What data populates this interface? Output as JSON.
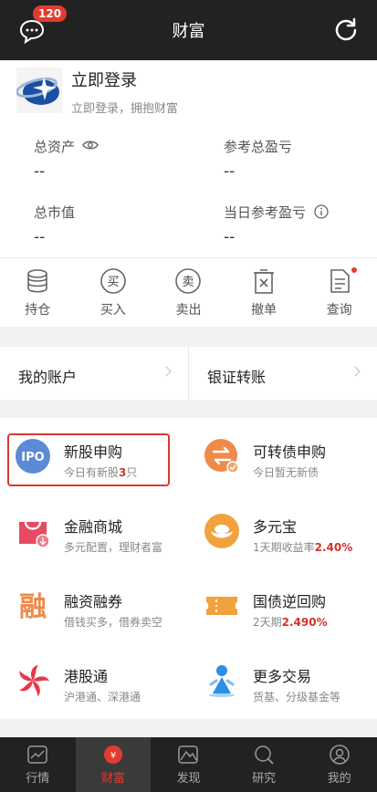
{
  "header": {
    "title": "财富",
    "message_badge": "120"
  },
  "account": {
    "login_title": "立即登录",
    "login_subtitle": "立即登录，拥抱财富",
    "stats": [
      {
        "label": "总资产",
        "value": "--"
      },
      {
        "label": "参考总盈亏",
        "value": "--"
      },
      {
        "label": "总市值",
        "value": "--"
      },
      {
        "label": "当日参考盈亏",
        "value": "--"
      }
    ]
  },
  "actions": [
    {
      "label": "持仓",
      "icon": "database-icon"
    },
    {
      "label": "买入",
      "icon": "buy-icon",
      "glyph": "买"
    },
    {
      "label": "卖出",
      "icon": "sell-icon",
      "glyph": "卖"
    },
    {
      "label": "撤单",
      "icon": "cancel-order-icon"
    },
    {
      "label": "查询",
      "icon": "query-icon"
    }
  ],
  "links": {
    "my_account": "我的账户",
    "bank_transfer": "银证转账"
  },
  "grid": [
    {
      "title": "新股申购",
      "sub_prefix": "今日有新股",
      "sub_highlight": "3",
      "sub_suffix": "只",
      "icon": "ipo-icon",
      "icon_text": "IPO"
    },
    {
      "title": "可转债申购",
      "sub_prefix": "今日暂无新债",
      "sub_highlight": "",
      "sub_suffix": "",
      "icon": "convertible-bond-icon"
    },
    {
      "title": "金融商城",
      "sub_prefix": "多元配置，理财者富",
      "sub_highlight": "",
      "sub_suffix": "",
      "icon": "shopping-bag-icon"
    },
    {
      "title": "多元宝",
      "sub_prefix": "1天期收益率",
      "sub_highlight": "2.40%",
      "sub_suffix": "",
      "icon": "gold-ingot-icon"
    },
    {
      "title": "融资融券",
      "sub_prefix": "借钱买多，借券卖空",
      "sub_highlight": "",
      "sub_suffix": "",
      "icon": "margin-trading-icon",
      "icon_text": "融"
    },
    {
      "title": "国债逆回购",
      "sub_prefix": "2天期",
      "sub_highlight": "2.490%",
      "sub_suffix": "",
      "icon": "ticket-icon"
    },
    {
      "title": "港股通",
      "sub_prefix": "沪港通、深港通",
      "sub_highlight": "",
      "sub_suffix": "",
      "icon": "bauhinia-icon"
    },
    {
      "title": "更多交易",
      "sub_prefix": "货基、分级基金等",
      "sub_highlight": "",
      "sub_suffix": "",
      "icon": "more-trade-icon"
    }
  ],
  "nav": [
    {
      "label": "行情",
      "icon": "chart-icon",
      "active": false
    },
    {
      "label": "财富",
      "icon": "wealth-icon",
      "active": true
    },
    {
      "label": "发现",
      "icon": "discover-icon",
      "active": false
    },
    {
      "label": "研究",
      "icon": "research-icon",
      "active": false
    },
    {
      "label": "我的",
      "icon": "profile-icon",
      "active": false
    }
  ],
  "colors": {
    "accent": "#e33b30",
    "header_bg": "#222222",
    "highlight_value": "#d3332b"
  }
}
